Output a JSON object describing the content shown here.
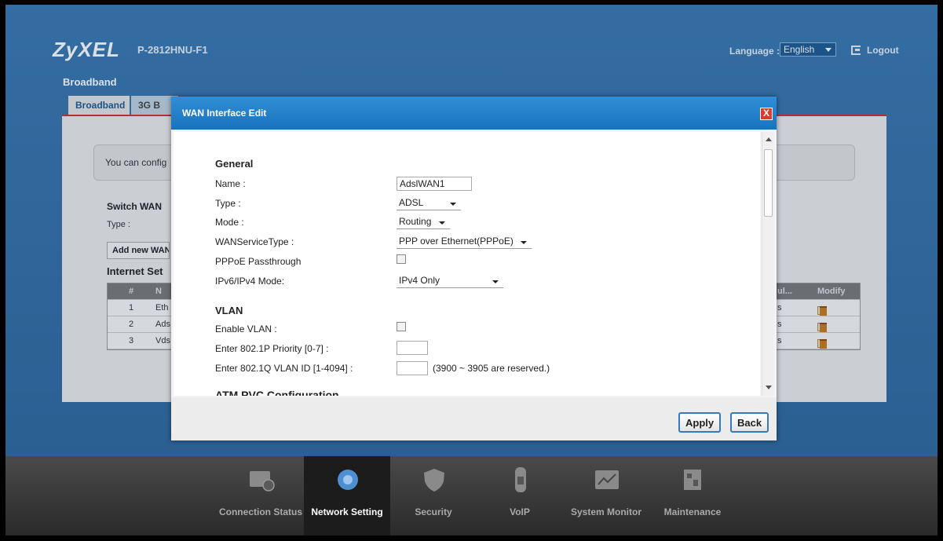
{
  "header": {
    "logo": "ZyXEL",
    "model": "P-2812HNU-F1",
    "language_label": "Language :",
    "language_value": "English",
    "logout_label": "Logout"
  },
  "breadcrumb": "Broadband",
  "tabs": [
    {
      "label": "Broadband"
    },
    {
      "label": "3G B"
    }
  ],
  "page": {
    "info_text": "You can config",
    "switch_title": "Switch WAN",
    "switch_type_label": "Type :",
    "add_wan_button": "Add new WAN",
    "internet_setup_title": "Internet Set",
    "table": {
      "headers": {
        "num": "#",
        "name": "N",
        "ul": "ul...",
        "modify": "Modify"
      },
      "rows": [
        {
          "num": "1",
          "name": "Eth",
          "ul": "s"
        },
        {
          "num": "2",
          "name": "Ads",
          "ul": "s"
        },
        {
          "num": "3",
          "name": "Vds",
          "ul": "s"
        }
      ]
    }
  },
  "dialog": {
    "title": "WAN Interface Edit",
    "close_glyph": "X",
    "general_section": "General",
    "name_label": "Name :",
    "name_value": "AdslWAN1",
    "type_label": "Type :",
    "type_value": "ADSL",
    "mode_label": "Mode :",
    "mode_value": "Routing",
    "wan_service_label": "WANServiceType :",
    "wan_service_value": "PPP over Ethernet(PPPoE)",
    "pppoe_passthrough_label": "PPPoE Passthrough",
    "ip_mode_label": "IPv6/IPv4 Mode:",
    "ip_mode_value": "IPv4 Only",
    "vlan_section": "VLAN",
    "enable_vlan_label": "Enable VLAN :",
    "priority_label": "Enter 802.1P Priority [0-7] :",
    "priority_value": "",
    "vlan_id_label": "Enter 802.1Q VLAN ID [1-4094] :",
    "vlan_id_value": "",
    "vlan_id_note": "(3900 ~ 3905 are reserved.)",
    "atm_section": "ATM PVC Configuration",
    "apply_button": "Apply",
    "back_button": "Back"
  },
  "nav": [
    {
      "label": "Connection Status",
      "icon": "connection-status-icon",
      "active": false
    },
    {
      "label": "Network Setting",
      "icon": "network-setting-icon",
      "active": true
    },
    {
      "label": "Security",
      "icon": "security-icon",
      "active": false
    },
    {
      "label": "VoIP",
      "icon": "voip-icon",
      "active": false
    },
    {
      "label": "System Monitor",
      "icon": "system-monitor-icon",
      "active": false
    },
    {
      "label": "Maintenance",
      "icon": "maintenance-icon",
      "active": false
    }
  ],
  "colors": {
    "title_bar": "#1a72bd",
    "close_button": "#e03a2a",
    "tab_accent": "#cc3333",
    "button_border": "#3c78b5"
  }
}
